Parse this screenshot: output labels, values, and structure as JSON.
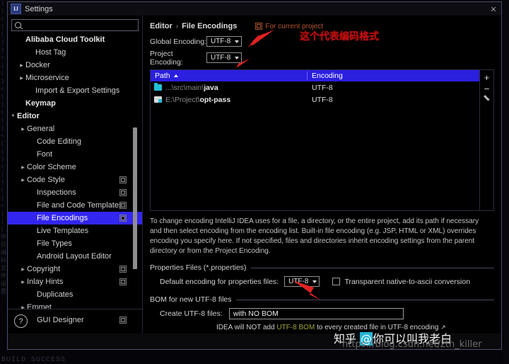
{
  "ide_background": {
    "left_strip_text": ")\n)\n<\n|\n(\n)\n)\n<\n|\n(\n)\n<\n|\n)\n(\n|\n)\n<\n(\n|\n)\n<\n|\n)\n(\n|\n<\n)\n|\n(\n中\n日\n编\n码\n文\n件\n设\n置",
    "build_status": "BUILD SUCCESS"
  },
  "window": {
    "title": "Settings",
    "app_icon": "intellij-idea-icon",
    "close_label": "✕"
  },
  "sidebar": {
    "search": {
      "value": "",
      "placeholder": "",
      "icon": "search-icon"
    },
    "items": [
      {
        "label": "Alibaba Cloud Toolkit",
        "bold": true,
        "indent": 14,
        "arrow": "",
        "config": false,
        "selected": false
      },
      {
        "label": "Host Tag",
        "bold": false,
        "indent": 28,
        "arrow": "",
        "config": false,
        "selected": false
      },
      {
        "label": "Docker",
        "bold": false,
        "indent": 14,
        "arrow": "▶",
        "config": false,
        "selected": false
      },
      {
        "label": "Microservice",
        "bold": false,
        "indent": 14,
        "arrow": "▶",
        "config": false,
        "selected": false
      },
      {
        "label": "Import & Export Settings",
        "bold": false,
        "indent": 28,
        "arrow": "",
        "config": false,
        "selected": false
      },
      {
        "label": "Keymap",
        "bold": true,
        "indent": 14,
        "arrow": "",
        "config": false,
        "selected": false
      },
      {
        "label": "Editor",
        "bold": true,
        "indent": 2,
        "arrow": "▼",
        "config": false,
        "selected": false
      },
      {
        "label": "General",
        "bold": false,
        "indent": 16,
        "arrow": "▶",
        "config": false,
        "selected": false
      },
      {
        "label": "Code Editing",
        "bold": false,
        "indent": 30,
        "arrow": "",
        "config": false,
        "selected": false
      },
      {
        "label": "Font",
        "bold": false,
        "indent": 30,
        "arrow": "",
        "config": false,
        "selected": false
      },
      {
        "label": "Color Scheme",
        "bold": false,
        "indent": 16,
        "arrow": "▶",
        "config": false,
        "selected": false
      },
      {
        "label": "Code Style",
        "bold": false,
        "indent": 16,
        "arrow": "▶",
        "config": true,
        "selected": false
      },
      {
        "label": "Inspections",
        "bold": false,
        "indent": 30,
        "arrow": "",
        "config": true,
        "selected": false
      },
      {
        "label": "File and Code Templates",
        "bold": false,
        "indent": 30,
        "arrow": "",
        "config": true,
        "selected": false
      },
      {
        "label": "File Encodings",
        "bold": false,
        "indent": 30,
        "arrow": "",
        "config": true,
        "selected": true
      },
      {
        "label": "Live Templates",
        "bold": false,
        "indent": 30,
        "arrow": "",
        "config": false,
        "selected": false
      },
      {
        "label": "File Types",
        "bold": false,
        "indent": 30,
        "arrow": "",
        "config": false,
        "selected": false
      },
      {
        "label": "Android Layout Editor",
        "bold": false,
        "indent": 30,
        "arrow": "",
        "config": false,
        "selected": false
      },
      {
        "label": "Copyright",
        "bold": false,
        "indent": 16,
        "arrow": "▶",
        "config": true,
        "selected": false
      },
      {
        "label": "Inlay Hints",
        "bold": false,
        "indent": 16,
        "arrow": "▶",
        "config": true,
        "selected": false
      },
      {
        "label": "Duplicates",
        "bold": false,
        "indent": 30,
        "arrow": "",
        "config": false,
        "selected": false
      },
      {
        "label": "Emmet",
        "bold": false,
        "indent": 16,
        "arrow": "▶",
        "config": false,
        "selected": false
      },
      {
        "label": "GUI Designer",
        "bold": false,
        "indent": 30,
        "arrow": "",
        "config": true,
        "selected": false
      }
    ],
    "help_button_label": "?"
  },
  "main": {
    "breadcrumb": {
      "parent": "Editor",
      "separator": "›",
      "current": "File Encodings"
    },
    "project_scope": {
      "label": "For current project",
      "icon": "project-scope-icon",
      "color": "#b4562e"
    },
    "global_encoding": {
      "label": "Global Encoding:",
      "value": "UTF-8"
    },
    "project_encoding": {
      "label": "Project Encoding:",
      "value": "UTF-8"
    },
    "annotation": {
      "text": "这个代表编码格式",
      "color": "#c01010"
    },
    "table": {
      "columns": [
        "Path",
        "Encoding"
      ],
      "sort_column": "Path",
      "sort_direction": "asc",
      "rows": [
        {
          "icon": "folder-icon",
          "path_prefix": "...\\src\\main\\",
          "path_name": "java",
          "encoding": "UTF-8"
        },
        {
          "icon": "module-icon",
          "path_prefix": "E:\\Project\\",
          "path_name": "opt-pass",
          "encoding": "UTF-8"
        }
      ],
      "toolbar": [
        {
          "icon": "add-icon",
          "label": "+"
        },
        {
          "icon": "remove-icon",
          "label": "−"
        },
        {
          "icon": "edit-pencil-icon",
          "label": ""
        }
      ]
    },
    "description": "To change encoding IntelliJ IDEA uses for a file, a directory, or the entire project, add its path if necessary and then select encoding from the encoding list. Built-in file encoding (e.g. JSP, HTML or XML) overrides encoding you specify here. If not specified, files and directories inherit encoding settings from the parent directory or from the Project Encoding.",
    "properties_group": {
      "title": "Properties Files (*.properties)",
      "default_encoding_label": "Default encoding for properties files:",
      "default_encoding_value": "UTF-8",
      "transparent_checkbox_label": "Transparent native-to-ascii conversion",
      "transparent_checkbox_checked": false
    },
    "bom_group": {
      "title": "BOM for new UTF-8 files",
      "create_label": "Create UTF-8 files:",
      "create_value": "with NO BOM",
      "note_prefix": "IDEA will NOT add ",
      "note_highlight": "UTF-8 BOM",
      "note_suffix": " to every created file in UTF-8 encoding",
      "note_external_icon": "↗",
      "note_highlight_color": "#a4a83a"
    }
  },
  "watermark": {
    "zhihu_prefix": "知乎 ",
    "zhihu_at": "@",
    "zhihu_name": "你可以叫我老白",
    "url": "https://blog.csdn.net/ztn_killer"
  }
}
